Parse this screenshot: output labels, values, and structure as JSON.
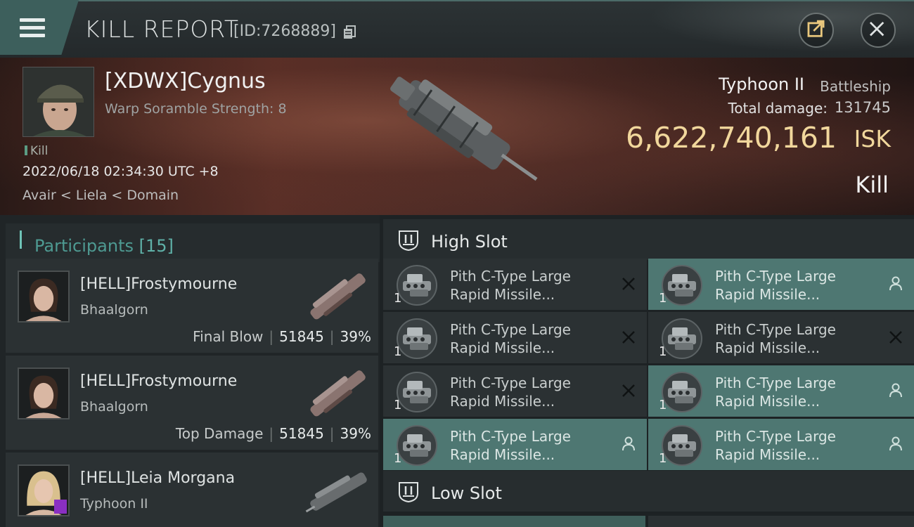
{
  "header": {
    "title": "KILL REPORT",
    "report_id": "[ID:7268889]"
  },
  "victim": {
    "name": "[XDWX]Cygnus",
    "scramble": "Warp Soramble Strength: 8",
    "tag": "Kill",
    "datetime": "2022/06/18 02:34:30 UTC +8",
    "location": "Avair < Liela < Domain",
    "ship": "Typhoon II",
    "ship_class": "Battleship",
    "total_damage_label": "Total damage:",
    "total_damage": "131745",
    "isk_value": "6,622,740,161",
    "isk_unit": "ISK",
    "result": "Kill"
  },
  "participants": {
    "title": "Participants",
    "count": "[15]",
    "items": [
      {
        "name": "[HELL]Frostymourne",
        "ship": "Bhaalgorn",
        "role": "Final Blow",
        "damage": "51845",
        "percent": "39%"
      },
      {
        "name": "[HELL]Frostymourne",
        "ship": "Bhaalgorn",
        "role": "Top Damage",
        "damage": "51845",
        "percent": "39%"
      },
      {
        "name": "[HELL]Leia Morgana",
        "ship": "Typhoon II"
      }
    ]
  },
  "fitting": {
    "high_slot_title": "High Slot",
    "low_slot_title": "Low Slot",
    "modules": [
      {
        "name": "Pith C-Type Large Rapid Missile...",
        "qty": "1",
        "status": "destroyed"
      },
      {
        "name": "Pith C-Type Large Rapid Missile...",
        "qty": "1",
        "status": "dropped"
      },
      {
        "name": "Pith C-Type Large Rapid Missile...",
        "qty": "1",
        "status": "destroyed"
      },
      {
        "name": "Pith C-Type Large Rapid Missile...",
        "qty": "1",
        "status": "destroyed"
      },
      {
        "name": "Pith C-Type Large Rapid Missile...",
        "qty": "1",
        "status": "destroyed"
      },
      {
        "name": "Pith C-Type Large Rapid Missile...",
        "qty": "1",
        "status": "dropped"
      },
      {
        "name": "Pith C-Type Large Rapid Missile...",
        "qty": "1",
        "status": "dropped"
      },
      {
        "name": "Pith C-Type Large Rapid Missile...",
        "qty": "1",
        "status": "dropped"
      }
    ]
  },
  "colors": {
    "accent_teal": "#4e9a92",
    "dropped_bg": "#4e7772",
    "isk_gold": "#f1d79c"
  },
  "icons": [
    "menu-icon",
    "copy-icon",
    "share-icon",
    "close-icon",
    "high-slot-icon",
    "low-slot-icon",
    "destroyed-x-icon",
    "dropped-person-icon"
  ]
}
